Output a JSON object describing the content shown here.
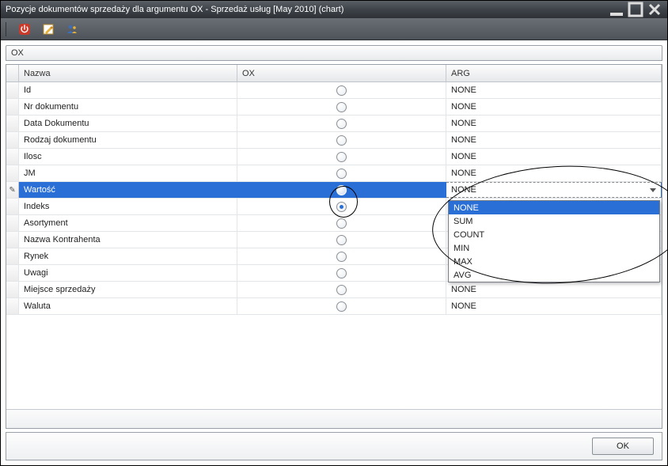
{
  "window": {
    "title": "Pozycje dokumentów sprzedaży dla argumentu OX - Sprzedaż usług [May 2010] (chart)"
  },
  "tab": {
    "label": "OX"
  },
  "columns": {
    "c1": "Nazwa",
    "c2": "OX",
    "c3": "ARG"
  },
  "rows": [
    {
      "nazwa": "Id",
      "ox_checked": false,
      "arg": "NONE",
      "selected": false,
      "editing": false
    },
    {
      "nazwa": "Nr dokumentu",
      "ox_checked": false,
      "arg": "NONE",
      "selected": false,
      "editing": false
    },
    {
      "nazwa": "Data Dokumentu",
      "ox_checked": false,
      "arg": "NONE",
      "selected": false,
      "editing": false
    },
    {
      "nazwa": "Rodzaj dokumentu",
      "ox_checked": false,
      "arg": "NONE",
      "selected": false,
      "editing": false
    },
    {
      "nazwa": "Ilosc",
      "ox_checked": false,
      "arg": "NONE",
      "selected": false,
      "editing": false
    },
    {
      "nazwa": "JM",
      "ox_checked": false,
      "arg": "NONE",
      "selected": false,
      "editing": false
    },
    {
      "nazwa": "Wartość",
      "ox_checked": false,
      "arg": "NONE",
      "selected": true,
      "editing": true,
      "arg_editor_open": true
    },
    {
      "nazwa": "Indeks",
      "ox_checked": true,
      "arg": "",
      "selected": false,
      "editing": false
    },
    {
      "nazwa": "Asortyment",
      "ox_checked": false,
      "arg": "",
      "selected": false,
      "editing": false
    },
    {
      "nazwa": "Nazwa Kontrahenta",
      "ox_checked": false,
      "arg": "",
      "selected": false,
      "editing": false
    },
    {
      "nazwa": "Rynek",
      "ox_checked": false,
      "arg": "",
      "selected": false,
      "editing": false
    },
    {
      "nazwa": "Uwagi",
      "ox_checked": false,
      "arg": "",
      "selected": false,
      "editing": false
    },
    {
      "nazwa": "Miejsce sprzedaży",
      "ox_checked": false,
      "arg": "NONE",
      "selected": false,
      "editing": false
    },
    {
      "nazwa": "Waluta",
      "ox_checked": false,
      "arg": "NONE",
      "selected": false,
      "editing": false
    }
  ],
  "arg_dropdown": {
    "options": [
      "NONE",
      "SUM",
      "COUNT",
      "MIN",
      "MAX",
      "AVG"
    ],
    "selected_index": 0
  },
  "buttons": {
    "ok": "OK"
  },
  "icons": {
    "power": "power-icon",
    "note": "note-icon",
    "users": "users-icon"
  }
}
